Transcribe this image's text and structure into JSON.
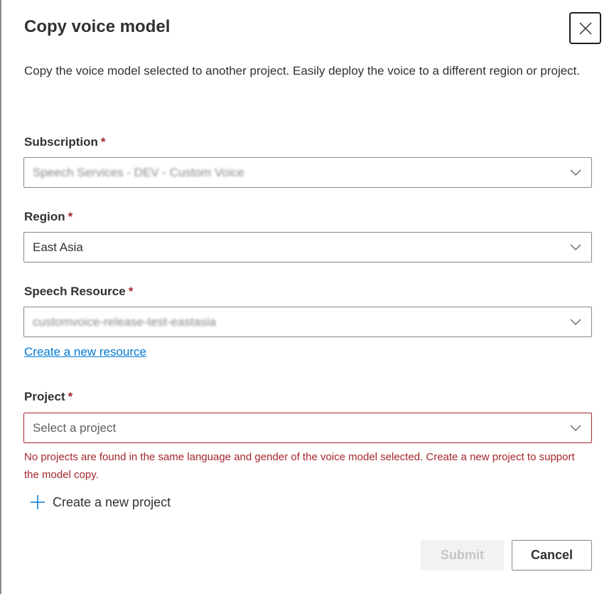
{
  "dialog": {
    "title": "Copy voice model",
    "description": "Copy the voice model selected to another project. Easily deploy the voice to a different region or project.",
    "required_marker": "*",
    "fields": {
      "subscription": {
        "label": "Subscription",
        "value": "Speech Services - DEV - Custom Voice"
      },
      "region": {
        "label": "Region",
        "value": "East Asia"
      },
      "speech_resource": {
        "label": "Speech Resource",
        "value": "customvoice-release-test-eastasia",
        "create_link": "Create a new resource"
      },
      "project": {
        "label": "Project",
        "placeholder": "Select a project",
        "error": "No projects are found in the same language and gender of the voice model selected. Create a new project to support the model copy.",
        "create_label": "Create a new project"
      }
    },
    "buttons": {
      "submit": "Submit",
      "cancel": "Cancel"
    },
    "colors": {
      "error": "#a4262c",
      "link": "#0078d4"
    }
  }
}
